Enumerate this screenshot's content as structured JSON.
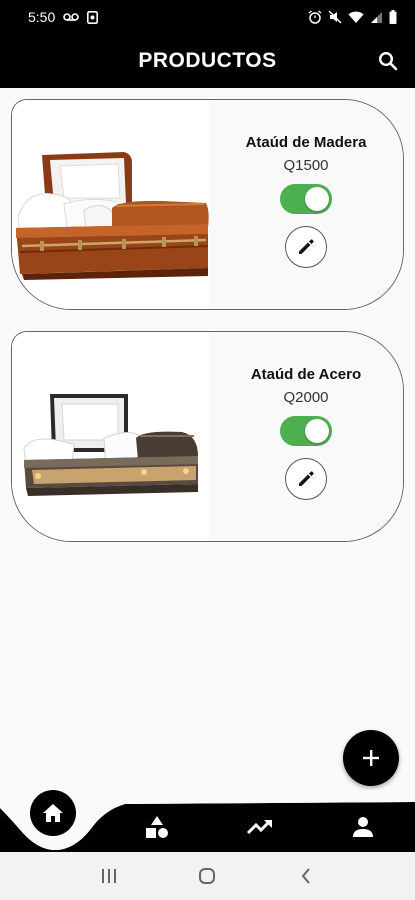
{
  "status_bar": {
    "time": "5:50",
    "left_icons": [
      "voicemail-icon",
      "notification-box-icon"
    ],
    "right_icons": [
      "alarm-icon",
      "mute-icon",
      "wifi-icon",
      "signal-icon",
      "battery-icon"
    ]
  },
  "header": {
    "title": "PRODUCTOS",
    "search_icon": "search-icon"
  },
  "products": [
    {
      "name": "Ataúd de Madera",
      "price": "Q1500",
      "enabled": true,
      "image": "wooden-casket"
    },
    {
      "name": "Ataúd de Acero",
      "price": "Q2000",
      "enabled": true,
      "image": "steel-casket"
    }
  ],
  "fab": {
    "icon": "plus-icon"
  },
  "bottom_nav": {
    "items": [
      {
        "name": "home",
        "icon": "home-icon",
        "active": true
      },
      {
        "name": "categories",
        "icon": "shapes-icon",
        "active": false
      },
      {
        "name": "stats",
        "icon": "trending-up-icon",
        "active": false
      },
      {
        "name": "profile",
        "icon": "person-icon",
        "active": false
      }
    ]
  },
  "system_nav": [
    "recents-icon",
    "home-circle-icon",
    "back-icon"
  ],
  "colors": {
    "bar_background": "#000000",
    "toggle_on": "#4caf50",
    "page_background": "#fafafa",
    "system_nav_background": "#f2f2f2"
  }
}
